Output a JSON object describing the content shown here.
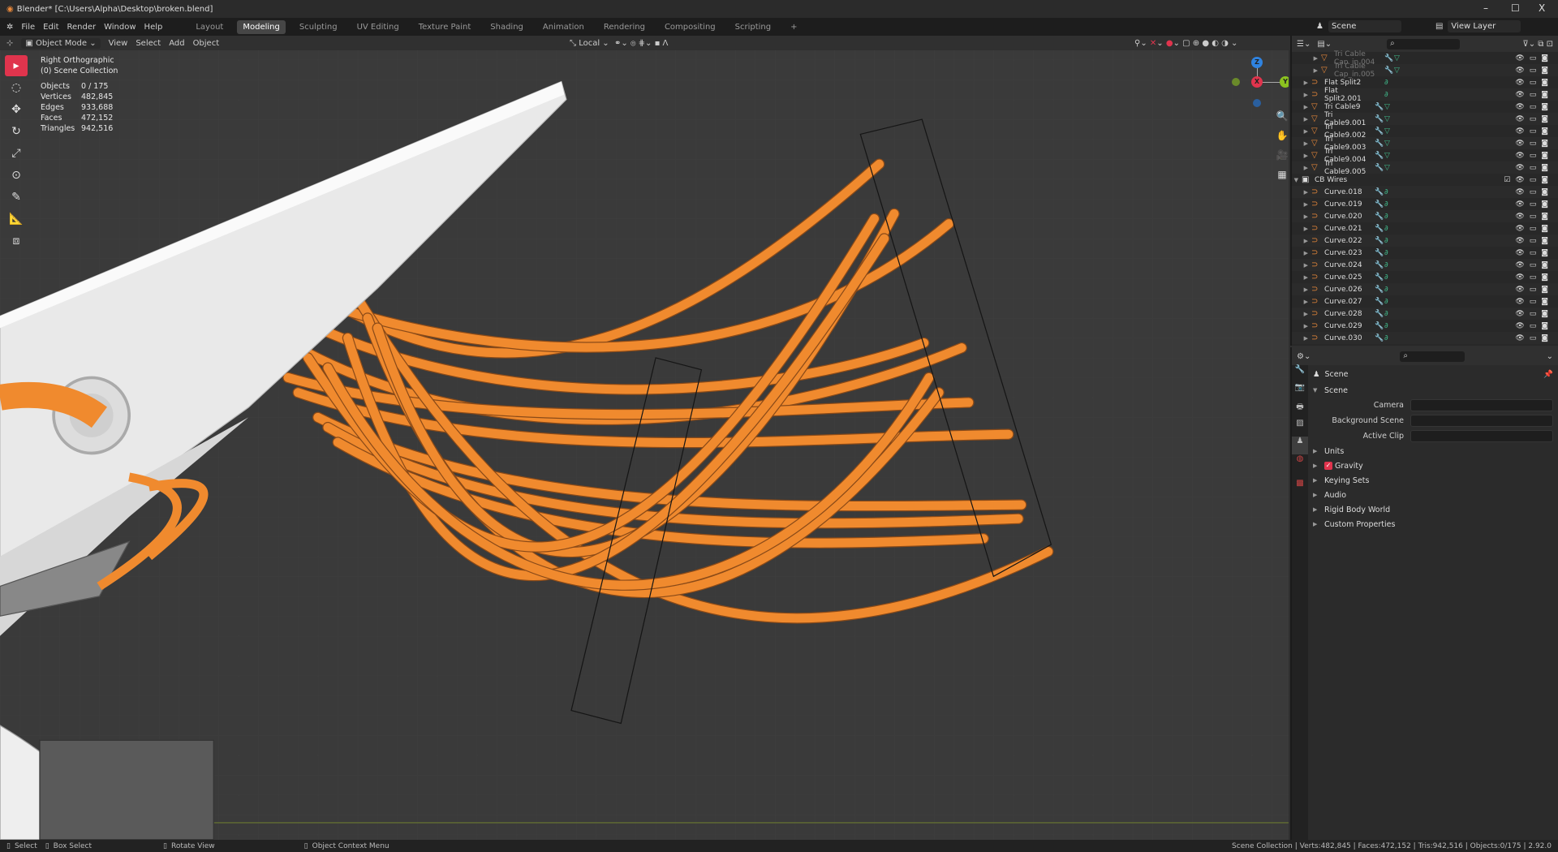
{
  "window": {
    "title": "Blender* [C:\\Users\\Alpha\\Desktop\\broken.blend]",
    "minimize": "–",
    "maximize": "☐",
    "close": "X"
  },
  "menu": [
    "File",
    "Edit",
    "Render",
    "Window",
    "Help"
  ],
  "workspaces": [
    "Layout",
    "Modeling",
    "Sculpting",
    "UV Editing",
    "Texture Paint",
    "Shading",
    "Animation",
    "Rendering",
    "Compositing",
    "Scripting",
    "+"
  ],
  "active_workspace": "Modeling",
  "scene_selector": {
    "scene": "Scene",
    "view_layer": "View Layer"
  },
  "viewport_header": {
    "mode": "Object Mode",
    "view": "View",
    "select": "Select",
    "add": "Add",
    "object": "Object",
    "transform_orientation": "Local"
  },
  "overlay": {
    "view_name": "Right Orthographic",
    "collection": "(0) Scene Collection",
    "stats": [
      {
        "label": "Objects",
        "value": "0 / 175"
      },
      {
        "label": "Vertices",
        "value": "482,845"
      },
      {
        "label": "Edges",
        "value": "933,688"
      },
      {
        "label": "Faces",
        "value": "472,152"
      },
      {
        "label": "Triangles",
        "value": "942,516"
      }
    ]
  },
  "gizmo": {
    "z": "Z",
    "x": "X",
    "y": "Y",
    "colors": {
      "x": "#e0344d",
      "y": "#8cc320",
      "z": "#2f83e0"
    }
  },
  "accent": "#e0344d",
  "cable_color": "#f08a2e",
  "outliner": {
    "rows": [
      {
        "name": "Tri Cable Cap_in.004",
        "type": "mesh",
        "dim": true
      },
      {
        "name": "Tri Cable Cap_in.005",
        "type": "mesh",
        "dim": true
      },
      {
        "name": "Flat Split2",
        "type": "curve"
      },
      {
        "name": "Flat Split2.001",
        "type": "curve"
      },
      {
        "name": "Tri Cable9",
        "type": "mesh"
      },
      {
        "name": "Tri Cable9.001",
        "type": "mesh"
      },
      {
        "name": "Tri Cable9.002",
        "type": "mesh"
      },
      {
        "name": "Tri Cable9.003",
        "type": "mesh"
      },
      {
        "name": "Tri Cable9.004",
        "type": "mesh"
      },
      {
        "name": "Tri Cable9.005",
        "type": "mesh"
      },
      {
        "name": "CB Wires",
        "type": "collection"
      },
      {
        "name": "Curve.018",
        "type": "curve"
      },
      {
        "name": "Curve.019",
        "type": "curve"
      },
      {
        "name": "Curve.020",
        "type": "curve"
      },
      {
        "name": "Curve.021",
        "type": "curve"
      },
      {
        "name": "Curve.022",
        "type": "curve"
      },
      {
        "name": "Curve.023",
        "type": "curve"
      },
      {
        "name": "Curve.024",
        "type": "curve"
      },
      {
        "name": "Curve.025",
        "type": "curve"
      },
      {
        "name": "Curve.026",
        "type": "curve"
      },
      {
        "name": "Curve.027",
        "type": "curve"
      },
      {
        "name": "Curve.028",
        "type": "curve"
      },
      {
        "name": "Curve.029",
        "type": "curve"
      },
      {
        "name": "Curve.030",
        "type": "curve"
      }
    ]
  },
  "properties": {
    "context": "Scene",
    "section": "Scene",
    "fields": [
      {
        "label": "Camera"
      },
      {
        "label": "Background Scene"
      },
      {
        "label": "Active Clip"
      }
    ],
    "panels": [
      {
        "label": "Units"
      },
      {
        "label": "Gravity",
        "checked": true
      },
      {
        "label": "Keying Sets"
      },
      {
        "label": "Audio"
      },
      {
        "label": "Rigid Body World"
      },
      {
        "label": "Custom Properties"
      }
    ]
  },
  "statusbar": {
    "select": "Select",
    "box_select": "Box Select",
    "rotate": "Rotate View",
    "context_menu": "Object Context Menu",
    "info": "Scene Collection | Verts:482,845 | Faces:472,152 | Tris:942,516 | Objects:0/175 | 2.92.0"
  }
}
